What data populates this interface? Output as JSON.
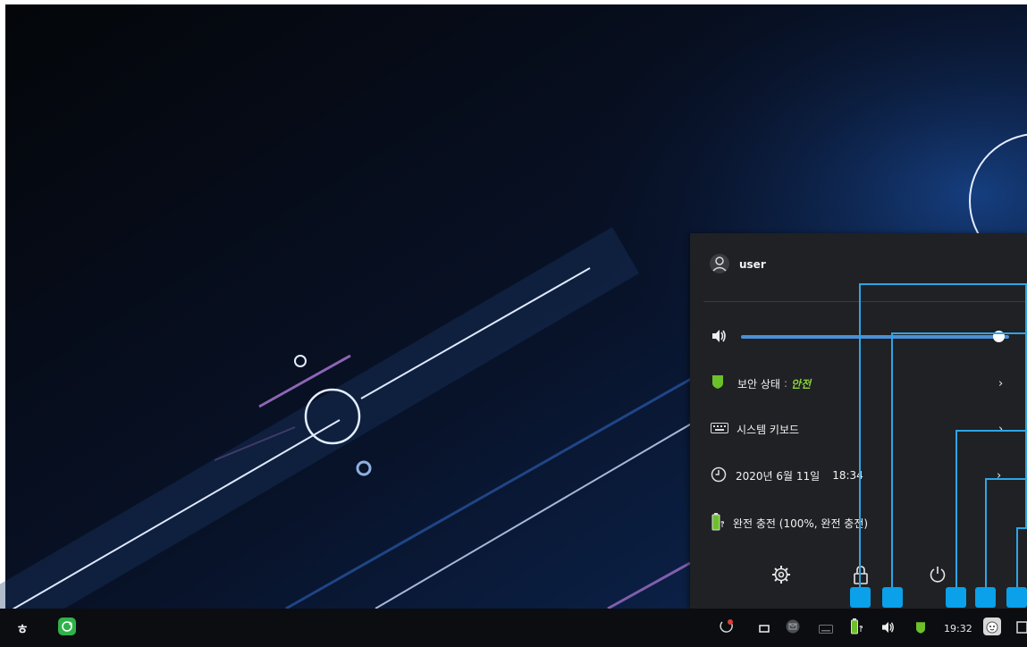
{
  "panel": {
    "user_name": "user",
    "security_label": "보안 상태",
    "security_separator": ":",
    "security_value": "안전",
    "keyboard_label": "시스템 키보드",
    "date": "2020년 6월 11일",
    "time": "18:34",
    "battery_text": "완전 충전 (100%, 완전 충전)",
    "chevron": "›",
    "volume_level_percent": 96
  },
  "taskbar": {
    "clock": "19:32",
    "launcher_glyph": "ㅎ"
  },
  "colors": {
    "panel_bg": "#1f2124",
    "accent_blue": "#4a90d9",
    "annotation_blue": "#0aa0ea",
    "safe_green": "#8bd33a",
    "shield_green": "#6cc02a"
  },
  "icons": [
    "user-icon",
    "speaker-icon",
    "shield-icon",
    "keyboard-icon",
    "clock-icon",
    "battery-icon",
    "settings-icon",
    "lock-icon",
    "power-icon"
  ]
}
